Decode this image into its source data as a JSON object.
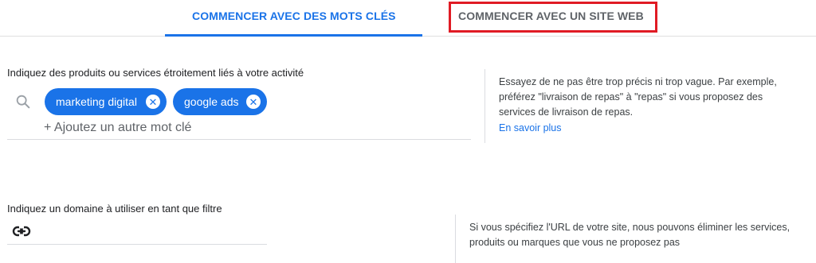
{
  "tabs": [
    {
      "label": "COMMENCER AVEC DES MOTS CLÉS",
      "active": true
    },
    {
      "label": "COMMENCER AVEC UN SITE WEB",
      "active": false
    }
  ],
  "keywords": {
    "label": "Indiquez des produits ou services étroitement liés à votre activité",
    "chips": [
      "marketing digital",
      "google ads"
    ],
    "add_placeholder": "+ Ajoutez un autre mot clé",
    "help_text": "Essayez de ne pas être trop précis ni trop vague. Par exemple, préférez \"livraison de repas\" à \"repas\" si vous proposez des services de livraison de repas.",
    "learn_more": "En savoir plus"
  },
  "domain": {
    "label": "Indiquez un domaine à utiliser en tant que filtre",
    "help_text": "Si vous spécifiez l'URL de votre site, nous pouvons éliminer les services, produits ou marques que vous ne proposez pas"
  },
  "colors": {
    "accent": "#1a73e8",
    "highlight": "#e01b24"
  },
  "icons": {
    "search": "search-icon",
    "chip_remove": "close-circle-icon",
    "link": "link-icon"
  }
}
